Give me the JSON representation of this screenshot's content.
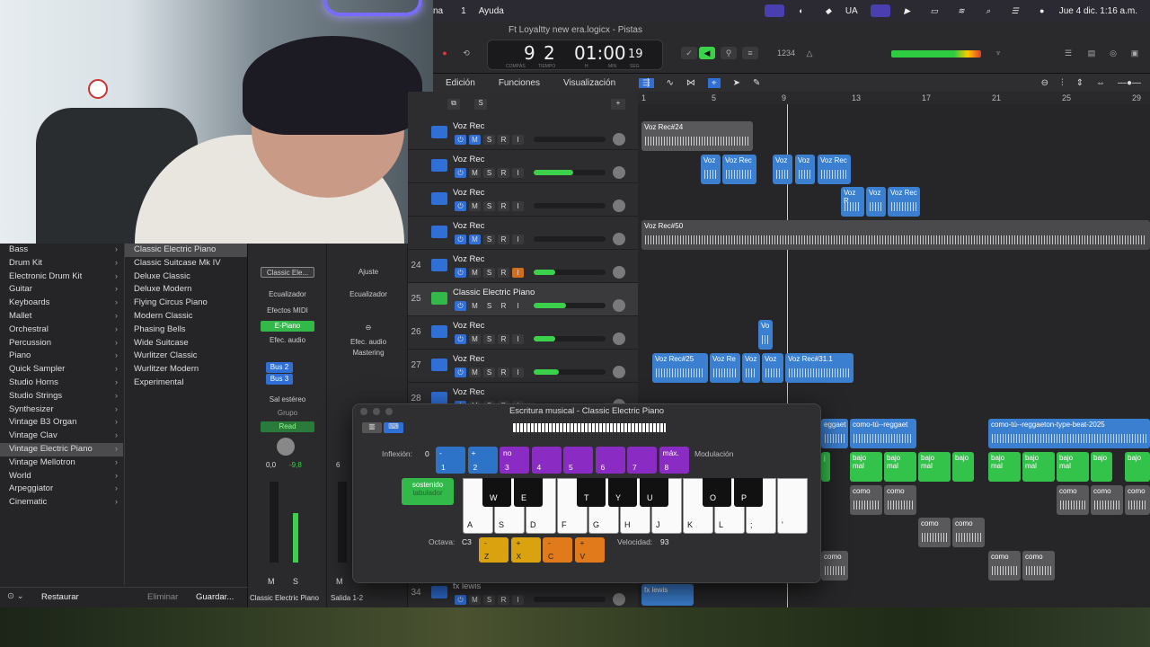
{
  "menubar": {
    "items": [
      "na",
      "1",
      "Ayuda"
    ],
    "status": [
      "UA"
    ],
    "datetime": "Jue 4 dic.  1:16 a.m."
  },
  "toolbar": {
    "title": "Ft Loyaltty new era.logicx - Pistas",
    "lcd_bars": "9",
    "lcd_beat": "2",
    "lcd_time": "01:00",
    "lcd_frames": "19",
    "lcd_lbl1": "COMPÁS",
    "lcd_lbl2": "TIEMPO",
    "lcd_lbl3": "H",
    "lcd_lbl4": "MIN",
    "lcd_lbl5": "SEG",
    "count": "1234"
  },
  "editbar": {
    "edit": "Edición",
    "functions": "Funciones",
    "view": "Visualización"
  },
  "library": {
    "categories": [
      {
        "label": "Bass",
        "sel": false
      },
      {
        "label": "Drum Kit",
        "sel": false
      },
      {
        "label": "Electronic Drum Kit",
        "sel": false
      },
      {
        "label": "Guitar",
        "sel": false
      },
      {
        "label": "Keyboards",
        "sel": false
      },
      {
        "label": "Mallet",
        "sel": false
      },
      {
        "label": "Orchestral",
        "sel": false
      },
      {
        "label": "Percussion",
        "sel": false
      },
      {
        "label": "Piano",
        "sel": false
      },
      {
        "label": "Quick Sampler",
        "sel": false
      },
      {
        "label": "Studio Horns",
        "sel": false
      },
      {
        "label": "Studio Strings",
        "sel": false
      },
      {
        "label": "Synthesizer",
        "sel": false
      },
      {
        "label": "Vintage B3 Organ",
        "sel": false
      },
      {
        "label": "Vintage Clav",
        "sel": false
      },
      {
        "label": "Vintage Electric Piano",
        "sel": true
      },
      {
        "label": "Vintage Mellotron",
        "sel": false
      },
      {
        "label": "World",
        "sel": false
      },
      {
        "label": "Arpeggiator",
        "sel": false
      },
      {
        "label": "Cinematic",
        "sel": false
      }
    ],
    "patches": [
      {
        "label": "Classic Electric Piano",
        "sel": true
      },
      {
        "label": "Classic Suitcase Mk IV",
        "sel": false
      },
      {
        "label": "Deluxe Classic",
        "sel": false
      },
      {
        "label": "Deluxe Modern",
        "sel": false
      },
      {
        "label": "Flying Circus Piano",
        "sel": false
      },
      {
        "label": "Modern Classic",
        "sel": false
      },
      {
        "label": "Phasing Bells",
        "sel": false
      },
      {
        "label": "Wide Suitcase",
        "sel": false
      },
      {
        "label": "Wurlitzer Classic",
        "sel": false
      },
      {
        "label": "Wurlitzer Modern",
        "sel": false
      },
      {
        "label": "Experimental",
        "sel": false
      }
    ],
    "restore": "Restaurar",
    "delete": "Eliminar",
    "save": "Guardar..."
  },
  "strips": {
    "s1": {
      "setting": "Classic Ele...",
      "eq": "Ecualizador",
      "midi": "Efectos MIDI",
      "instrument": "E-Piano",
      "audiofx": "Efec. audio",
      "bus1": "Bus 2",
      "bus2": "Bus 3",
      "out": "Sal estéreo",
      "group": "Grupo",
      "read": "Read",
      "pan": "0,0",
      "level": "-9,8",
      "m": "M",
      "s": "S",
      "name": "Classic Electric Piano"
    },
    "s2": {
      "setting": "Ajuste",
      "eq": "Ecualizador",
      "audiofx": "Efec. audio",
      "mastering": "Mastering",
      "pan": "6",
      "m": "M",
      "name": "Salida 1-2"
    }
  },
  "tracks": [
    {
      "num": "",
      "name": "Voz Rec",
      "fill": 0,
      "muted": true,
      "rec": false
    },
    {
      "num": "",
      "name": "Voz Rec",
      "fill": 0.55,
      "muted": false,
      "rec": false
    },
    {
      "num": "",
      "name": "Voz Rec",
      "fill": 0,
      "muted": false,
      "rec": false
    },
    {
      "num": "",
      "name": "Voz Rec",
      "fill": 0,
      "muted": true,
      "rec": false
    },
    {
      "num": "24",
      "name": "Voz Rec",
      "fill": 0.3,
      "muted": false,
      "rec": true
    },
    {
      "num": "25",
      "name": "Classic Electric Piano",
      "fill": 0.45,
      "muted": false,
      "rec": false
    },
    {
      "num": "26",
      "name": "Voz Rec",
      "fill": 0.3,
      "muted": false,
      "rec": false
    },
    {
      "num": "27",
      "name": "Voz Rec",
      "fill": 0.35,
      "muted": false,
      "rec": false
    },
    {
      "num": "28",
      "name": "Voz Rec",
      "fill": 0,
      "muted": false,
      "rec": false
    },
    {
      "num": "34",
      "name": "fx lewis",
      "fill": 0,
      "muted": false,
      "rec": false
    }
  ],
  "ruler": [
    "1",
    "5",
    "9",
    "13",
    "17",
    "21",
    "25",
    "29"
  ],
  "regions": {
    "r1": "Voz Rec#24",
    "r2": "Voz",
    "r3": "Voz Rec",
    "r4": "Voz",
    "r5": "Voz",
    "r6": "Voz Rec",
    "r7": "Voz R",
    "r8": "Voz",
    "r9": "Voz Rec",
    "r10": "Voz Rec#50",
    "r11": "Vo",
    "r12": "Voz Rec#25",
    "r13": "Voz Re",
    "r14": "Voz",
    "r15": "Voz",
    "r16": "Voz Rec#31.1",
    "r17": "eggaet",
    "r18": "como-tú--reggaet",
    "r19": "como-tú--reggaeton-type-beat-2025",
    "r20": "bajo mal",
    "r21": "bajo mal",
    "r22": "bajo mal",
    "r23": "bajo",
    "r24": "bajo mal",
    "r25": "bajo mal",
    "r26": "bajo mal",
    "r27": "bajo",
    "r28": "bajo",
    "r29": "como",
    "r30": "como",
    "r31": "como",
    "r32": "como",
    "r33": "como",
    "r34": "como",
    "r35": "como",
    "r36": "como",
    "r37": "como",
    "r38": "como",
    "r39": "fx lewis",
    "r40": "j"
  },
  "typing": {
    "title": "Escritura musical - Classic Electric Piano",
    "inflexion": "Inflexión:",
    "inf_val": "0",
    "modulacion": "Modulación",
    "pads": [
      {
        "top": "-",
        "bottom": "1",
        "color": "#2d74c9"
      },
      {
        "top": "+",
        "bottom": "2",
        "color": "#2d74c9"
      },
      {
        "top": "no",
        "bottom": "3",
        "color": "#8a2bc4"
      },
      {
        "top": "",
        "bottom": "4",
        "color": "#8a2bc4"
      },
      {
        "top": "",
        "bottom": "5",
        "color": "#8a2bc4"
      },
      {
        "top": "",
        "bottom": "6",
        "color": "#8a2bc4"
      },
      {
        "top": "",
        "bottom": "7",
        "color": "#8a2bc4"
      },
      {
        "top": "máx.",
        "bottom": "8",
        "color": "#8a2bc4"
      }
    ],
    "sustain1": "sostenido",
    "sustain2": "tabulador",
    "white_keys": [
      "A",
      "S",
      "D",
      "F",
      "G",
      "H",
      "J",
      "K",
      "L",
      ";",
      "'"
    ],
    "black_keys": [
      "W",
      "E",
      "T",
      "Y",
      "U",
      "O",
      "P"
    ],
    "octava": "Octava:",
    "oct_val": "C3",
    "oct_pads": [
      {
        "top": "-",
        "bottom": "Z",
        "color": "#d9a20e"
      },
      {
        "top": "+",
        "bottom": "X",
        "color": "#d9a20e"
      },
      {
        "top": "-",
        "bottom": "C",
        "color": "#e07a1a"
      },
      {
        "top": "+",
        "bottom": "V",
        "color": "#e07a1a"
      }
    ],
    "velocidad": "Velocidad:",
    "vel_val": "93"
  }
}
